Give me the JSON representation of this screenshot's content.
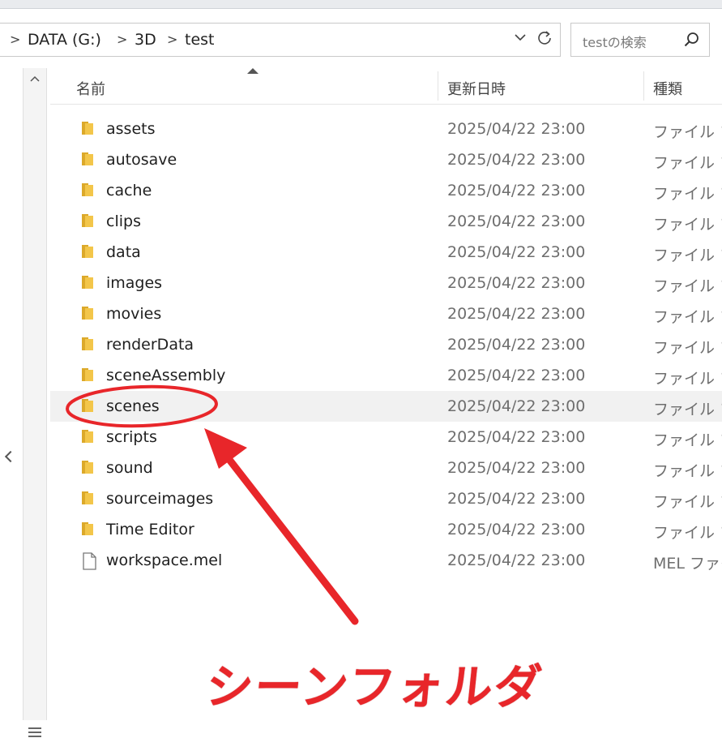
{
  "breadcrumb": {
    "items": [
      "DATA (G:)",
      "3D",
      "test"
    ],
    "separator": ">"
  },
  "address": {
    "dropdown_icon": "chevron-down-icon",
    "refresh_icon": "refresh-icon"
  },
  "search": {
    "placeholder": "testの検索",
    "icon": "search-icon"
  },
  "columns": {
    "name": "名前",
    "modified": "更新日時",
    "type": "種類"
  },
  "files": [
    {
      "name": "assets",
      "date": "2025/04/22 23:00",
      "type": "ファイル フォ",
      "kind": "folder"
    },
    {
      "name": "autosave",
      "date": "2025/04/22 23:00",
      "type": "ファイル フォ",
      "kind": "folder"
    },
    {
      "name": "cache",
      "date": "2025/04/22 23:00",
      "type": "ファイル フォ",
      "kind": "folder"
    },
    {
      "name": "clips",
      "date": "2025/04/22 23:00",
      "type": "ファイル フォ",
      "kind": "folder"
    },
    {
      "name": "data",
      "date": "2025/04/22 23:00",
      "type": "ファイル フォ",
      "kind": "folder"
    },
    {
      "name": "images",
      "date": "2025/04/22 23:00",
      "type": "ファイル フォ",
      "kind": "folder"
    },
    {
      "name": "movies",
      "date": "2025/04/22 23:00",
      "type": "ファイル フォ",
      "kind": "folder"
    },
    {
      "name": "renderData",
      "date": "2025/04/22 23:00",
      "type": "ファイル フォ",
      "kind": "folder"
    },
    {
      "name": "sceneAssembly",
      "date": "2025/04/22 23:00",
      "type": "ファイル フォ",
      "kind": "folder"
    },
    {
      "name": "scenes",
      "date": "2025/04/22 23:00",
      "type": "ファイル フォ",
      "kind": "folder",
      "selected": true
    },
    {
      "name": "scripts",
      "date": "2025/04/22 23:00",
      "type": "ファイル フォ",
      "kind": "folder"
    },
    {
      "name": "sound",
      "date": "2025/04/22 23:00",
      "type": "ファイル フォ",
      "kind": "folder"
    },
    {
      "name": "sourceimages",
      "date": "2025/04/22 23:00",
      "type": "ファイル フォ",
      "kind": "folder"
    },
    {
      "name": "Time Editor",
      "date": "2025/04/22 23:00",
      "type": "ファイル フォ",
      "kind": "folder"
    },
    {
      "name": "workspace.mel",
      "date": "2025/04/22 23:00",
      "type": "MEL ファイ",
      "kind": "file"
    }
  ],
  "annotation": {
    "caption": "シーンフォルダ",
    "color": "#e8262a"
  },
  "colors": {
    "folder": "#f3c64a",
    "folder_dark": "#dca92a",
    "selected_row": "#f1f1f1"
  }
}
